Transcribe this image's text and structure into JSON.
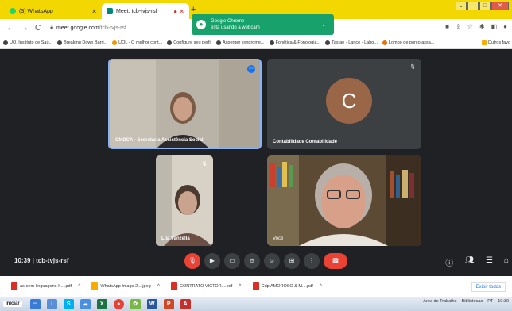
{
  "browser": {
    "tabs": [
      {
        "title": "(3) WhatsApp",
        "favicon_color": "#25d366"
      },
      {
        "title": "Meet: tcb-tvjs-rsf",
        "favicon_color": "#00897b",
        "active": true
      }
    ],
    "new_tab": "+",
    "url_host": "meet.google.com",
    "url_path": "/tcb-tvjs-rsf",
    "bookmarks": [
      "UO, Instituto de Saú...",
      "Breaking Down Barri...",
      "UOL - O melhor cont...",
      "Configure seu perfil",
      "Asperger syndrome...",
      "Fonética & Fonologia...",
      "Tastae - Lance - Labo...",
      "Lombo de porco assa...",
      "Outros favo"
    ]
  },
  "toast": {
    "line1": "Google Chrome",
    "line2": "está usando a webcam"
  },
  "meet": {
    "participants": [
      {
        "name": "CMDCA - Secretaria Assistência Social",
        "speaking": true
      },
      {
        "name": "Contabilidade Contabilidade",
        "avatar_letter": "C",
        "avatar_color": "#9a6648"
      },
      {
        "name": "Lila Vanzella"
      },
      {
        "name": "Você"
      }
    ],
    "time": "10:39",
    "meeting_code": "tcb-tvjs-rsf",
    "clock_text": "10:39  |  tcb-tvjs-rsf"
  },
  "downloads": {
    "items": [
      {
        "label": "as-cem-linguagens-h....pdf",
        "color": "#d93025"
      },
      {
        "label": "WhatsApp Image 2....jpeg",
        "color": "#f9ab00"
      },
      {
        "label": "CONTRATO VICTOR....pdf",
        "color": "#d93025"
      },
      {
        "label": "Cdp AMOROSO & M....pdf",
        "color": "#d93025"
      }
    ],
    "show_all": "Exibir todos"
  },
  "taskbar": {
    "start": "Iniciar",
    "tray_text": "Área de Trabalho",
    "libraries": "Bibliotecas",
    "lang": "PT",
    "clock": "10:39"
  }
}
